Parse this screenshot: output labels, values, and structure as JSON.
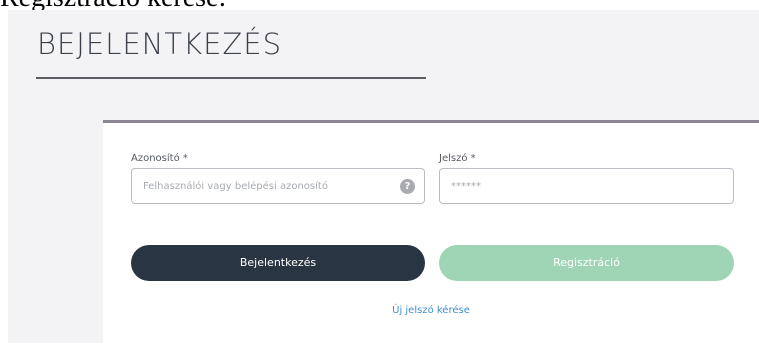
{
  "top_caption": "Regisztráció kérése:",
  "page": {
    "title": "BEJELENTKEZÉS"
  },
  "login_form": {
    "username_label": "Azonosító *",
    "username_placeholder": "Felhasználói vagy belépési azonosító",
    "help_icon_glyph": "?",
    "password_label": "Jelszó *",
    "password_placeholder": "******",
    "login_button": "Bejelentkezés",
    "register_button": "Regisztráció",
    "forgot_password_link": "Új jelszó kérése"
  },
  "colors": {
    "page_background": "#f3f3f5",
    "login_button": "#293542",
    "register_button": "#9fd5b4",
    "link": "#3d8fd0",
    "card_top_border": "#8b8592"
  },
  "icons": {
    "help": "question-mark-circle-icon"
  }
}
